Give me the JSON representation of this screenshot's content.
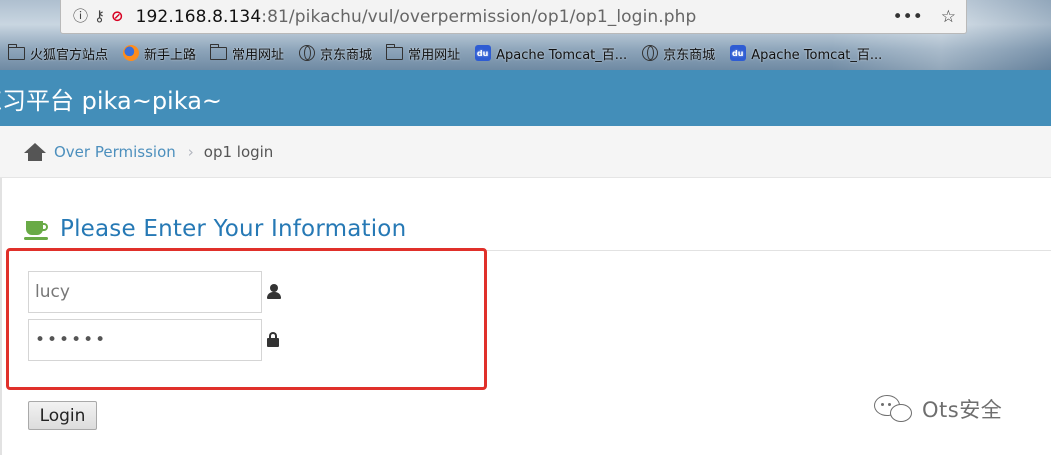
{
  "browser": {
    "url_host": "192.168.8.134",
    "url_rest": ":81/pikachu/vul/overpermission/op1/op1_login.php",
    "menu_icon": "more-dots-icon",
    "star_icon": "bookmark-star-icon",
    "bookmarks": [
      {
        "label": "火狐官方站点",
        "icon": "folder-icon"
      },
      {
        "label": "新手上路",
        "icon": "firefox-icon"
      },
      {
        "label": "常用网址",
        "icon": "folder-icon"
      },
      {
        "label": "京东商城",
        "icon": "globe-icon"
      },
      {
        "label": "常用网址",
        "icon": "folder-icon"
      },
      {
        "label": "Apache Tomcat_百...",
        "icon": "baidu-paw-icon"
      },
      {
        "label": "京东商城",
        "icon": "globe-icon"
      },
      {
        "label": "Apache Tomcat_百...",
        "icon": "baidu-paw-icon"
      }
    ]
  },
  "header": {
    "title": "练习平台 pika~pika~",
    "color": "#438eb9"
  },
  "breadcrumb": {
    "parent": "Over Permission",
    "current": "op1 login"
  },
  "login": {
    "heading": "Please Enter Your Information",
    "username_value": "lucy",
    "password_value": "••••••",
    "button_label": "Login",
    "highlight_color": "#e0302a"
  },
  "watermark": {
    "text": "Ots安全"
  }
}
